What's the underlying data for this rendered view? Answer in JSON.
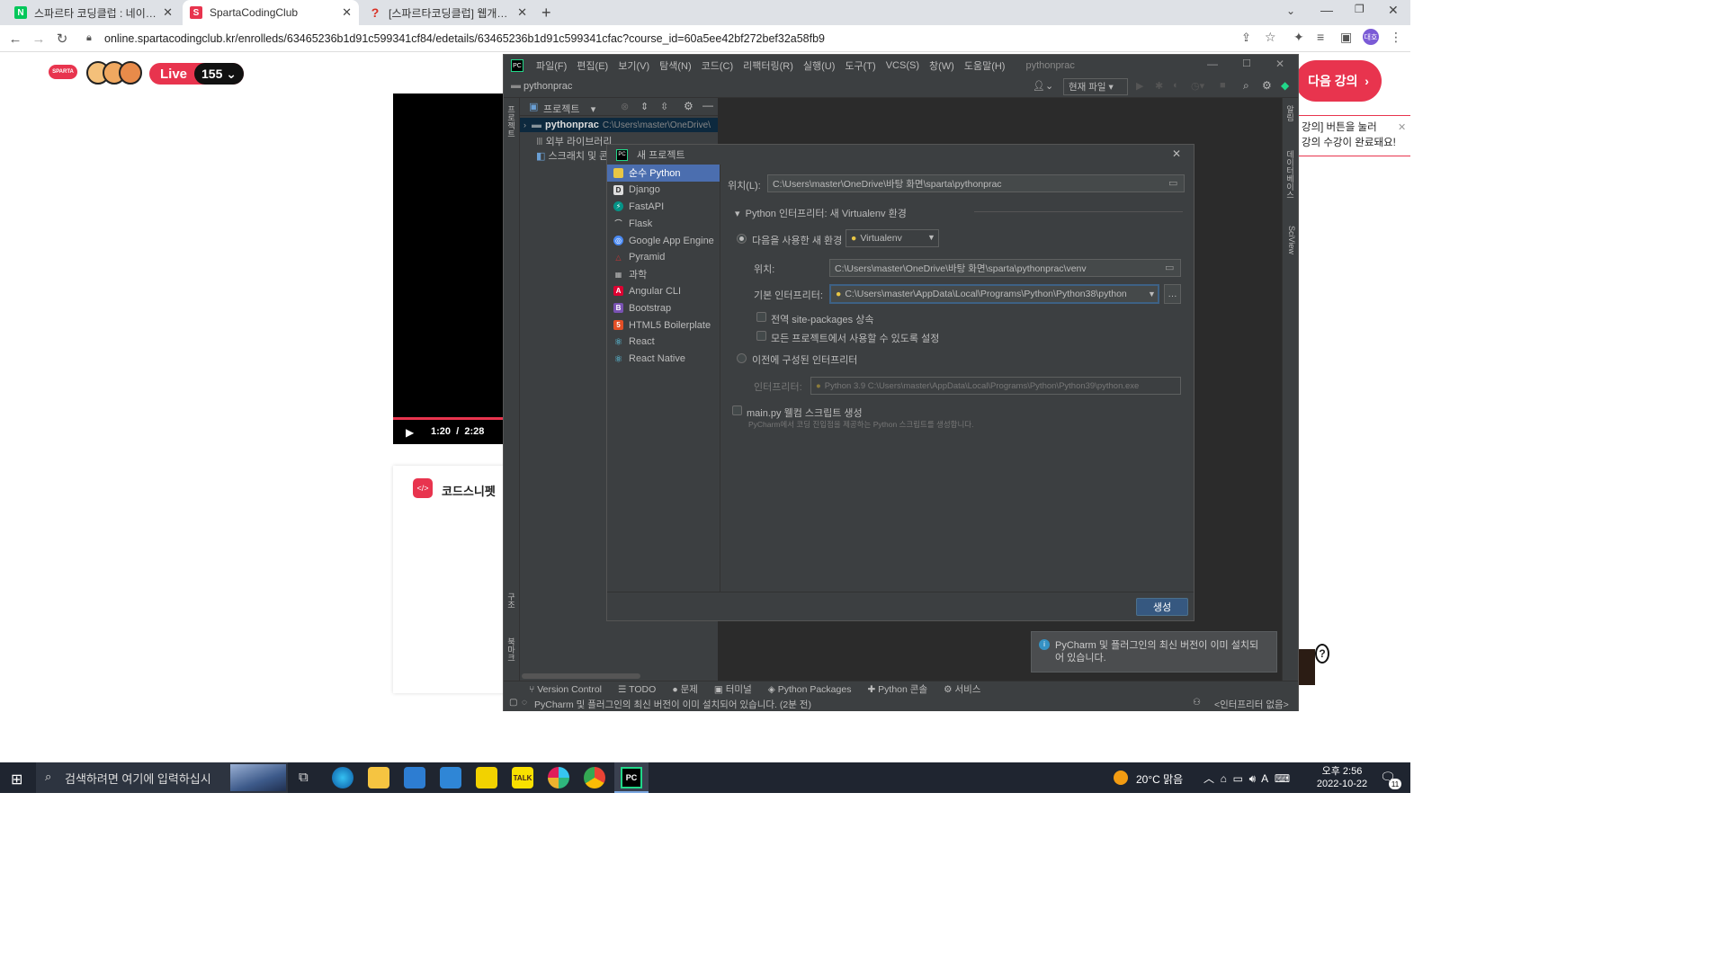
{
  "browser": {
    "tabs": [
      {
        "title": "스파르타 코딩클럽 : 네이버 통합",
        "favicon": "N",
        "color": "#03c75a"
      },
      {
        "title": "SpartaCodingClub",
        "favicon": "S",
        "color": "#e8344e"
      },
      {
        "title": "[스파르타코딩클럽] 웹개발 종합",
        "favicon": "?",
        "color": "#d93025"
      }
    ],
    "url": "online.spartacodingclub.kr/enrolleds/63465236b1d91c599341cf84/edetails/63465236b1d91c599341cfac?course_id=60a5ee42bf272bef32a58fb9",
    "profile": "대호"
  },
  "page": {
    "logo": "SPARTA",
    "live_label": "Live",
    "live_count": "155",
    "video_time_current": "1:20",
    "video_time_sep": "/",
    "video_time_total": "2:28",
    "codesnippet_label": "코드스니펫",
    "next_button": "다음 강의",
    "tooltip_line1": "강의] 버튼을 눌러",
    "tooltip_line2": "강의 수강이 완료돼요!"
  },
  "pycharm": {
    "menu": [
      "파일(F)",
      "편집(E)",
      "보기(V)",
      "탐색(N)",
      "코드(C)",
      "리팩터링(R)",
      "실행(U)",
      "도구(T)",
      "VCS(S)",
      "창(W)",
      "도움말(H)"
    ],
    "window_title": "pythonprac",
    "project_name": "pythonprac",
    "run_config": "현재 파일",
    "project_tab": "프로젝트",
    "tree": {
      "root": "pythonprac",
      "root_path": "C:\\Users\\master\\OneDrive\\",
      "external_libs": "외부 라이브러리",
      "scratches": "스크래치 및 콘"
    },
    "left_strip": "프로젝트",
    "left_strip_bottom1": "구조",
    "left_strip_bottom2": "북마크",
    "right_strip1": "알림",
    "right_strip2": "데이터베이스",
    "right_strip3": "SciView",
    "bottom_tools": [
      "Version Control",
      "TODO",
      "문제",
      "터미널",
      "Python Packages",
      "Python 콘솔",
      "서비스"
    ],
    "status_text": "PyCharm 및 플러그인의 최신 버전이 이미 설치되어 있습니다. (2분 전)",
    "status_right": "<인터프리터 없음>",
    "notification": "PyCharm 및 플러그인의 최신 버전이 이미 설치되어 있습니다."
  },
  "dialog": {
    "title": "새 프로젝트",
    "project_types": [
      "순수 Python",
      "Django",
      "FastAPI",
      "Flask",
      "Google App Engine",
      "Pyramid",
      "과학",
      "Angular CLI",
      "Bootstrap",
      "HTML5 Boilerplate",
      "React",
      "React Native"
    ],
    "selected_index": 0,
    "location_label": "위치(L):",
    "location_value": "C:\\Users\\master\\OneDrive\\바탕 화면\\sparta\\pythonprac",
    "interpreter_section": "Python 인터프리터: 새 Virtualenv 환경",
    "new_env_label": "다음을 사용한 새 환경",
    "new_env_value": "Virtualenv",
    "venv_location_label": "위치:",
    "venv_location_value": "C:\\Users\\master\\OneDrive\\바탕 화면\\sparta\\pythonprac\\venv",
    "base_interp_label": "기본 인터프리터:",
    "base_interp_value": "C:\\Users\\master\\AppData\\Local\\Programs\\Python\\Python38\\python",
    "inherit_label": "전역 site-packages 상속",
    "share_label": "모든 프로젝트에서 사용할 수 있도록 설정",
    "prev_interp_label": "이전에 구성된 인터프리터",
    "interp_label": "인터프리터:",
    "interp_value": "Python 3.9 C:\\Users\\master\\AppData\\Local\\Programs\\Python\\Python39\\python.exe",
    "main_py_label": "main.py 웰컴 스크립트 생성",
    "main_py_desc": "PyCharm에서 코딩 진입점을 제공하는 Python 스크립트를 생성합니다.",
    "create_button": "생성"
  },
  "taskbar": {
    "search_placeholder": "검색하려면 여기에 입력하십시",
    "weather": "20°C 맑음",
    "time": "오후 2:56",
    "date": "2022-10-22",
    "notif_count": "11"
  }
}
